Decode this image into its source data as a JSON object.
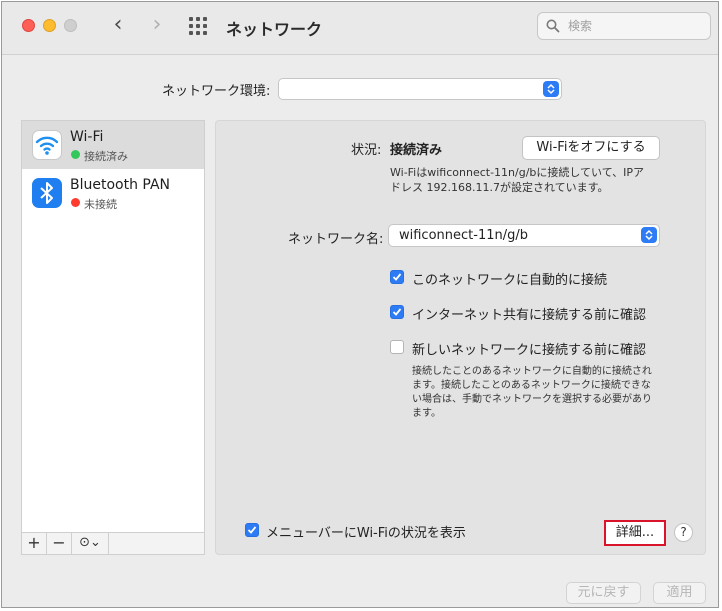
{
  "window": {
    "title": "ネットワーク"
  },
  "search": {
    "placeholder": "検索"
  },
  "location": {
    "label": "ネットワーク環境:",
    "value": ""
  },
  "services": [
    {
      "name": "Wi-Fi",
      "status": "接続済み",
      "status_color": "#34c759",
      "icon": "wifi-icon",
      "selected": true
    },
    {
      "name": "Bluetooth PAN",
      "status": "未接続",
      "status_color": "#ff3b30",
      "icon": "bluetooth-icon",
      "selected": false
    }
  ],
  "sidebar_controls": {
    "add": "+",
    "remove": "−",
    "action": "⊙⌄"
  },
  "detail": {
    "status_label": "状況:",
    "status_value": "接続済み",
    "toggle_button": "Wi-Fiをオフにする",
    "desc_line1": "Wi-Fiはwificonnect-11n/g/bに接続していて、IPア",
    "desc_line2": "ドレス 192.168.11.7が設定されています。",
    "network_label": "ネットワーク名:",
    "network_value": "wificonnect-11n/g/b",
    "auto_join": {
      "label": "このネットワークに自動的に接続",
      "checked": true
    },
    "ask_hotspot": {
      "label": "インターネット共有に接続する前に確認",
      "checked": true
    },
    "ask_new": {
      "label": "新しいネットワークに接続する前に確認",
      "checked": false
    },
    "note_line1": "接続したことのあるネットワークに自動的に接続され",
    "note_line2": "ます。接続したことのあるネットワークに接続できな",
    "note_line3": "い場合は、手動でネットワークを選択する必要があり",
    "note_line4": "ます。",
    "menubar": {
      "label": "メニューバーにWi-Fiの状況を表示",
      "checked": true
    },
    "advanced_button": "詳細...",
    "help_button": "?"
  },
  "footer": {
    "revert": "元に戻す",
    "apply": "適用"
  },
  "colors": {
    "accent": "#2d7cf6",
    "highlight": "#d9142a"
  }
}
